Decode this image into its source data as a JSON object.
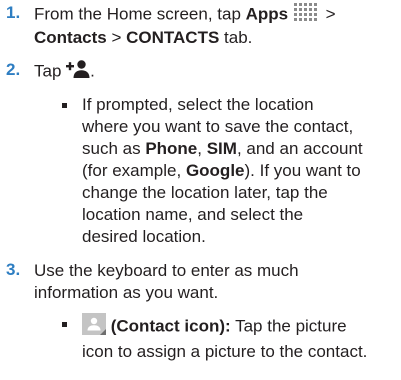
{
  "steps": [
    {
      "number": "1.",
      "line1_pre": "From the Home screen, tap ",
      "line1_bold": "Apps",
      "line1_post": " >",
      "line2_bold1": "Contacts",
      "line2_sep": " > ",
      "line2_bold2": "CONTACTS",
      "line2_post": " tab."
    },
    {
      "number": "2.",
      "text_pre": "Tap ",
      "text_post": ".",
      "icon": "add-contact-icon",
      "bullet": {
        "l1": "If prompted, select the location",
        "l2": "where you want to save the contact,",
        "l3_pre": "such as ",
        "l3_b1": "Phone",
        "l3_sep1": ", ",
        "l3_b2": "SIM",
        "l3_post": ", and an account",
        "l4_pre": "(for example, ",
        "l4_b": "Google",
        "l4_post": "). If you want to",
        "l5": "change the location later, tap the",
        "l6": "location name, and select the",
        "l7": "desired location."
      }
    },
    {
      "number": "3.",
      "l1": "Use the keyboard to enter as much",
      "l2": "information as you want.",
      "bullet": {
        "icon": "contact-picture-icon",
        "bold": "(Contact icon):",
        "l1_post": " Tap the picture",
        "l2": "icon to assign a picture to the contact."
      }
    }
  ],
  "colors": {
    "step_number": "#2e7ec2",
    "text": "#231f20",
    "apps_icon": "#8a8a8a"
  }
}
